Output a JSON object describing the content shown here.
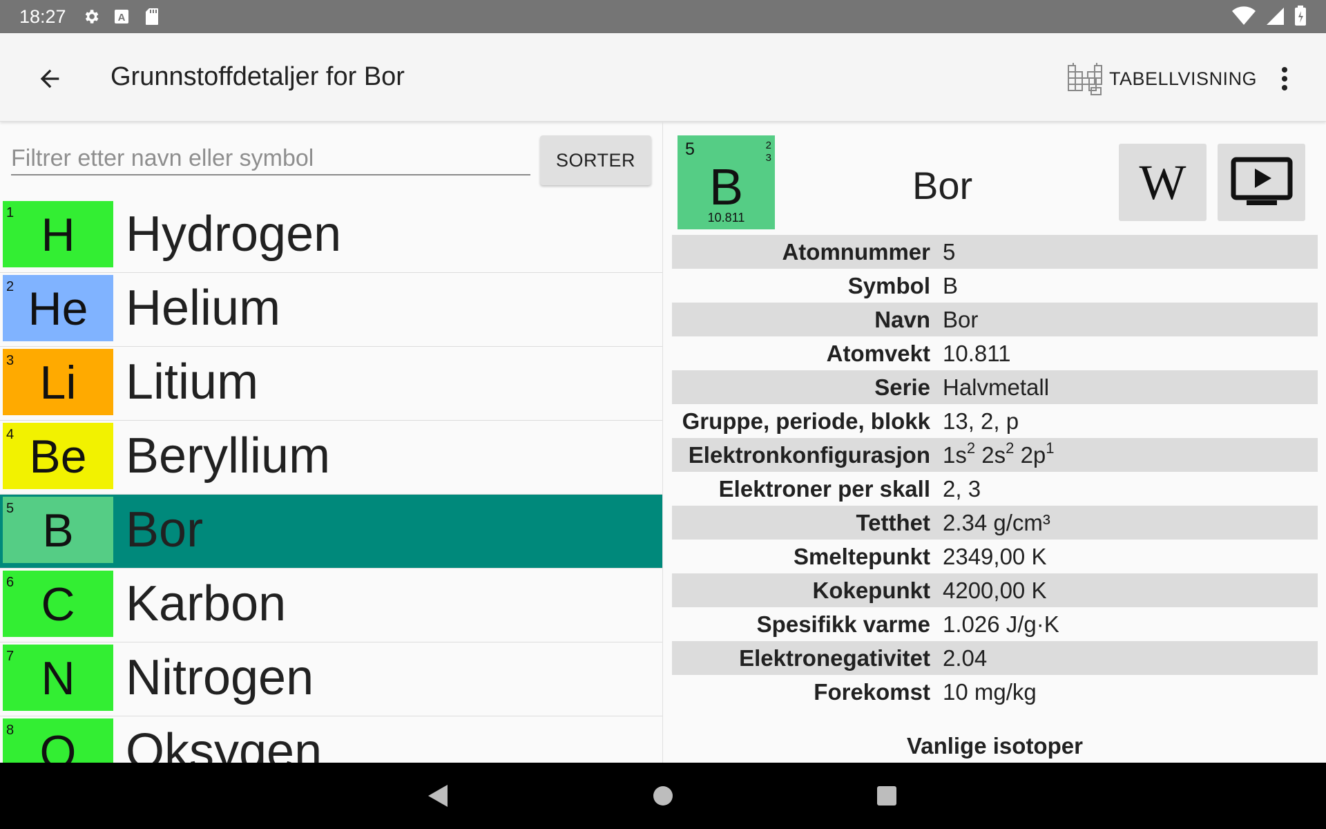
{
  "status_bar": {
    "time": "18:27",
    "icons": [
      "gear-icon",
      "text-a-icon",
      "sdcard-icon"
    ],
    "right_icons": [
      "wifi-icon",
      "signal-icon",
      "battery-icon"
    ]
  },
  "app_bar": {
    "title": "Grunnstoffdetaljer for Bor",
    "table_view_label": "TABELLVISNING"
  },
  "filter": {
    "placeholder": "Filtrer etter navn eller symbol",
    "value": "",
    "sort_label": "SORTER"
  },
  "elements": [
    {
      "number": "1",
      "symbol": "H",
      "name": "Hydrogen",
      "color": "#33ee33"
    },
    {
      "number": "2",
      "symbol": "He",
      "name": "Helium",
      "color": "#80b3ff"
    },
    {
      "number": "3",
      "symbol": "Li",
      "name": "Litium",
      "color": "#ffaa00"
    },
    {
      "number": "4",
      "symbol": "Be",
      "name": "Beryllium",
      "color": "#f2f200"
    },
    {
      "number": "5",
      "symbol": "B",
      "name": "Bor",
      "color": "#55cd85",
      "selected": true
    },
    {
      "number": "6",
      "symbol": "C",
      "name": "Karbon",
      "color": "#33ee33"
    },
    {
      "number": "7",
      "symbol": "N",
      "name": "Nitrogen",
      "color": "#33ee33"
    },
    {
      "number": "8",
      "symbol": "O",
      "name": "Oksygen",
      "color": "#33ee33"
    }
  ],
  "detail": {
    "tile": {
      "number": "5",
      "symbol": "B",
      "shell1": "2",
      "shell2": "3",
      "mass": "10.811",
      "color": "#55cd85"
    },
    "name": "Bor",
    "wiki_label": "W",
    "properties": [
      {
        "label": "Atomnummer",
        "value": "5"
      },
      {
        "label": "Symbol",
        "value": "B"
      },
      {
        "label": "Navn",
        "value": "Bor"
      },
      {
        "label": "Atomvekt",
        "value": "10.811"
      },
      {
        "label": "Serie",
        "value": "Halvmetall"
      },
      {
        "label": "Gruppe, periode, blokk",
        "value": "13, 2, p"
      },
      {
        "label": "Elektronkonfigurasjon",
        "config": [
          {
            "base": "1s",
            "sup": "2"
          },
          {
            "base": "2s",
            "sup": "2"
          },
          {
            "base": "2p",
            "sup": "1"
          }
        ]
      },
      {
        "label": "Elektroner per skall",
        "value": "2, 3"
      },
      {
        "label": "Tetthet",
        "value": "2.34 g/cm³"
      },
      {
        "label": "Smeltepunkt",
        "value": "2349,00 K"
      },
      {
        "label": "Kokepunkt",
        "value": "4200,00 K"
      },
      {
        "label": "Spesifikk varme",
        "value": "1.026 J/g·K"
      },
      {
        "label": "Elektronegativitet",
        "value": "2.04"
      },
      {
        "label": "Forekomst",
        "value": "10 mg/kg"
      }
    ],
    "isotopes_heading": "Vanlige isotoper"
  },
  "colors": {
    "selected_row": "#00897b",
    "status_bar": "#757575",
    "shade_row": "#dcdcdc"
  },
  "nav_bar": {
    "icons": [
      "back-triangle-icon",
      "home-circle-icon",
      "recents-square-icon"
    ]
  }
}
